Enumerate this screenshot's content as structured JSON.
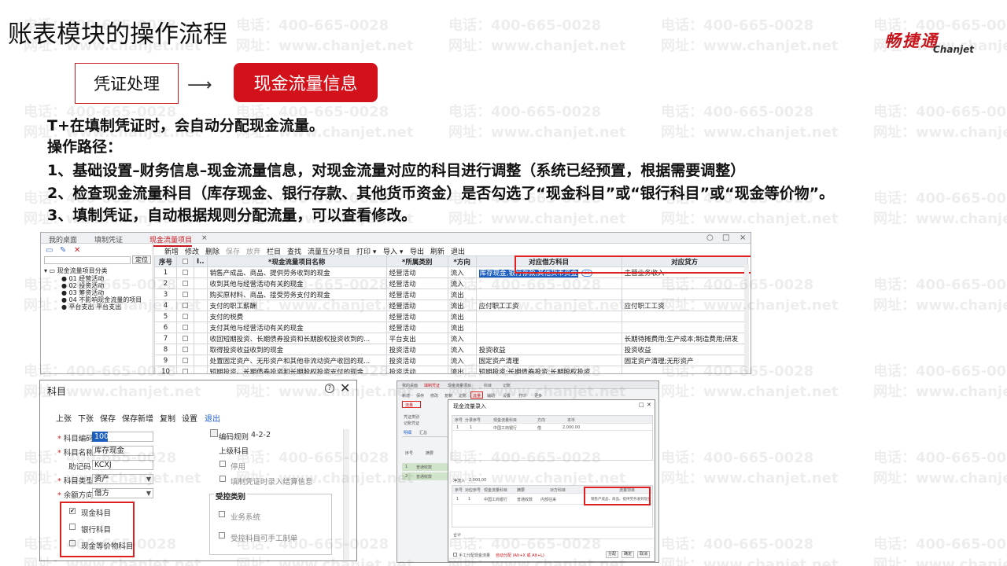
{
  "page": {
    "title": "账表模块的操作流程",
    "logo_cn": "畅捷通",
    "logo_en": "Chanjet",
    "watermark_phone": "电话：400-665-0028",
    "watermark_web": "网址：www.chanjet.net"
  },
  "flow": {
    "step1": "凭证处理",
    "arrow": "⟶",
    "step2": "现金流量信息"
  },
  "text": {
    "line1": "T+在填制凭证时，会自动分配现金流量。",
    "line2": "操作路径：",
    "line3": "1、基础设置–财务信息–现金流量信息，对现金流量对应的科目进行调整（系统已经预置，根据需要调整）",
    "line4": "2、检查现金流量科目（库存现金、银行存款、其他货币资金）是否勾选了“现金科目”或“银行科目”或“现金等价物”。",
    "line5": "3、填制凭证，自动根据规则分配流量，可以查看修改。"
  },
  "ss1": {
    "tabs": [
      "我的桌面",
      "填制凭证",
      "现金流量项目"
    ],
    "tab_close": "×",
    "win_buttons": [
      "○",
      "□",
      "×"
    ],
    "mini_toolbar": [
      "▭",
      "✎",
      "✕"
    ],
    "filter_button": "定位",
    "tree": [
      "现金流量项目分类",
      "01 经营活动",
      "02 投资活动",
      "03 筹资活动",
      "04 不影响现金流量的项目",
      "平台支出  平台支出"
    ],
    "toolbar": [
      "新增",
      "修改",
      "删除",
      "保存",
      "放弃",
      "栏目",
      "查找",
      "流量互分项目",
      "打印 ▾",
      "导入 ▾",
      "导出",
      "刷新",
      "退出"
    ],
    "columns": [
      "序号",
      "",
      "I..",
      "*现金流量项目名称",
      "*所属类别",
      "*方向",
      "对应借方科目",
      "对应贷方"
    ],
    "rows": [
      [
        "1",
        "销售产成品、商品、提供劳务收到的现金",
        "经营活动",
        "流入",
        "库存现金,银行存款,其他货币资金",
        "主营业务收入"
      ],
      [
        "2",
        "收到其他与经营活动有关的现金",
        "经营活动",
        "流入",
        "",
        ""
      ],
      [
        "3",
        "购买原材料、商品、接受劳务支付的现金",
        "经营活动",
        "流出",
        "",
        ""
      ],
      [
        "4",
        "支付的职工薪酬",
        "经营活动",
        "流出",
        "应付职工工资",
        "应付职工工资"
      ],
      [
        "5",
        "支付的税费",
        "经营活动",
        "流出",
        "",
        ""
      ],
      [
        "6",
        "支付其他与经营活动有关的现金",
        "经营活动",
        "流出",
        "",
        ""
      ],
      [
        "7",
        "收回短期投资、长期债券投资和长期股权投资收到的...",
        "平台支出",
        "流入",
        "",
        "长期待摊费用;生产成本;制造费用;研发"
      ],
      [
        "8",
        "取得投资收益收到的现金",
        "投资活动",
        "流入",
        "投资收益",
        "投资收益"
      ],
      [
        "9",
        "处置固定资产、无形资产和其他非流动资产收回的现...",
        "投资活动",
        "流入",
        "固定资产清理",
        "固定资产清理;无形资产"
      ],
      [
        "10",
        "短期投资、长期债券投资和长期股权投资支付的现金",
        "投资活动",
        "流出",
        "短期投资;长期债券投资;长期股权投资",
        ""
      ]
    ],
    "ref_icon": "oo"
  },
  "ss2": {
    "title": "科目",
    "help": "?",
    "close": "✕",
    "toolbar": [
      "上张",
      "下张",
      "保存",
      "保存新增",
      "复制",
      "设置",
      "退出"
    ],
    "fields": {
      "code_label": "科目编码",
      "code_value": "1001",
      "name_label": "科目名称",
      "name_value": "库存现金",
      "mnemonic_label": "助记码",
      "mnemonic_value": "KCXJ",
      "type_label": "科目类型",
      "type_value": "资产",
      "direction_label": "余额方向",
      "direction_value": "借方",
      "coding_rule_label": "编码规则",
      "coding_rule_value": "4-2-2",
      "parent_label": "上级科目",
      "disabled_label": "停用",
      "settle_label": "填制凭证时录入结算信息"
    },
    "checkboxes": [
      {
        "label": "现金科目",
        "checked": "✔"
      },
      {
        "label": "银行科目",
        "checked": ""
      },
      {
        "label": "现金等价物科目",
        "checked": ""
      }
    ],
    "controlled_group": "受控类别",
    "controlled_items": [
      "业务系统",
      "受控科目可手工制单"
    ]
  },
  "ss3": {
    "top_tabs": [
      "我的桌面",
      "填制凭证",
      "现金流量项目",
      "科目",
      "记账"
    ],
    "toolbar": [
      "新增",
      "保存",
      "修改",
      "复制",
      "记账",
      "流量",
      "辅助",
      "设置",
      "打印",
      "更多"
    ],
    "left_labels": [
      "流量",
      "凭证类别",
      "记账凭证"
    ],
    "left_tabs": [
      "明细",
      "汇总"
    ],
    "left_cols": [
      "序号",
      "摘要"
    ],
    "left_rows": [
      {
        "no": "1",
        "text": "普通收款"
      },
      {
        "no": "2",
        "text": "普通收款"
      }
    ],
    "dialog_title": "现金流量录入",
    "dialog_close": "✕",
    "grid1_cols": [
      "序号",
      "分录序号",
      "现金流量科目",
      "方向",
      "本币"
    ],
    "grid1_row": [
      "1",
      "1",
      "中国工商银行",
      "借",
      "2,000.00"
    ],
    "net_label": "净流入",
    "net_value": "2,000.00",
    "grid2_cols": [
      "序号",
      "对应序号",
      "现金流量科目",
      "摘要",
      "对方科目",
      "流量项目"
    ],
    "grid2_row": [
      "1",
      "1",
      "中国工商银行",
      "普通收款",
      "内部往来",
      "销售产成品、商品、提供劳务收到现金"
    ],
    "sum_label": "合计",
    "footer_check": "手工分配现金流量",
    "footer_hint": "自动分配 (Alt+X 或 Alt+L)",
    "footer_buttons": [
      "分配",
      "确定",
      "取消"
    ]
  }
}
